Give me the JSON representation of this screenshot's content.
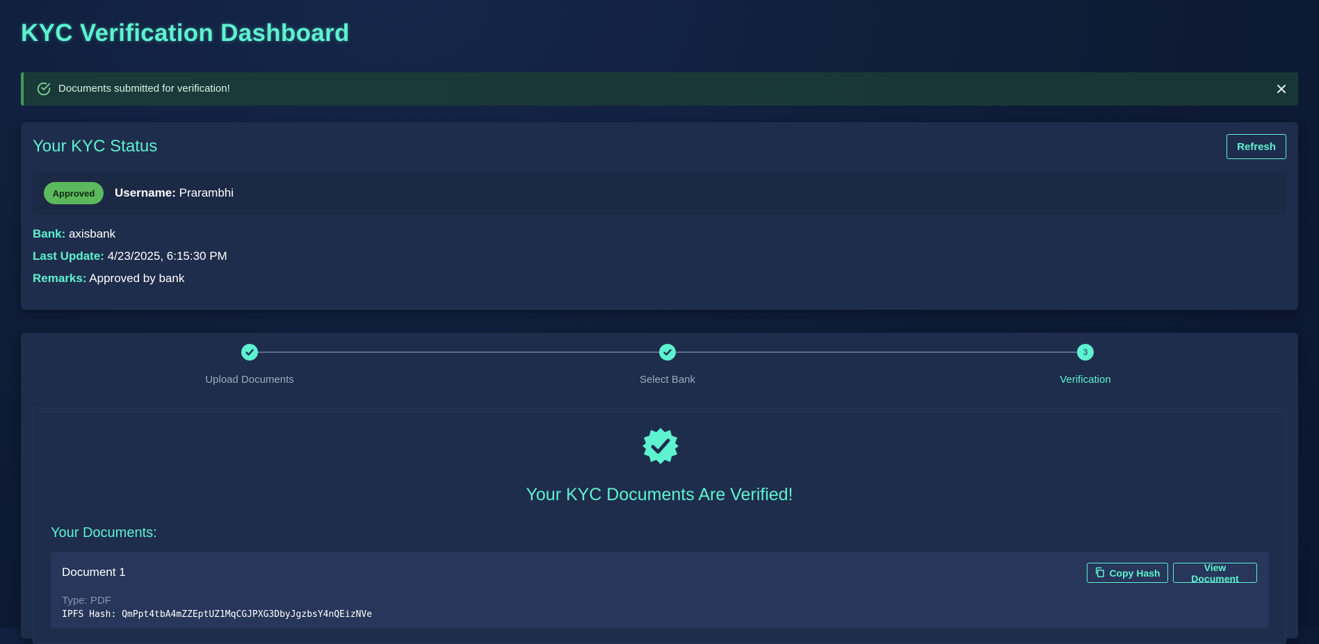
{
  "page": {
    "title": "KYC Verification Dashboard"
  },
  "alert": {
    "message": "Documents submitted for verification!",
    "icon": "check-circle-icon",
    "close_icon": "close-icon"
  },
  "status": {
    "title": "Your KYC Status",
    "refresh_label": "Refresh",
    "badge": "Approved",
    "username_label": "Username:",
    "username": "Prarambhi",
    "bank_label": "Bank:",
    "bank": "axisbank",
    "last_update_label": "Last Update:",
    "last_update": "4/23/2025, 6:15:30 PM",
    "remarks_label": "Remarks:",
    "remarks": "Approved by bank"
  },
  "stepper": {
    "steps": [
      {
        "label": "Upload Documents",
        "state": "done",
        "marker": "check-icon"
      },
      {
        "label": "Select Bank",
        "state": "done",
        "marker": "check-icon"
      },
      {
        "label": "Verification",
        "state": "active",
        "marker": "3"
      }
    ]
  },
  "verification": {
    "icon": "verified-badge-icon",
    "title": "Your KYC Documents Are Verified!",
    "documents_heading": "Your Documents:",
    "documents": [
      {
        "name": "Document 1",
        "type": "Type: PDF",
        "hash": "IPFS Hash: QmPpt4tbA4mZZEptUZ1MqCGJPXG3DbyJgzbsY4nQEizNVe",
        "copy_label": "Copy Hash",
        "view_label": "View Document"
      }
    ]
  },
  "colors": {
    "accent": "#5ef2d0",
    "success": "#5cb85c",
    "card": "#1f2d4c",
    "background": "#0e1b35"
  }
}
